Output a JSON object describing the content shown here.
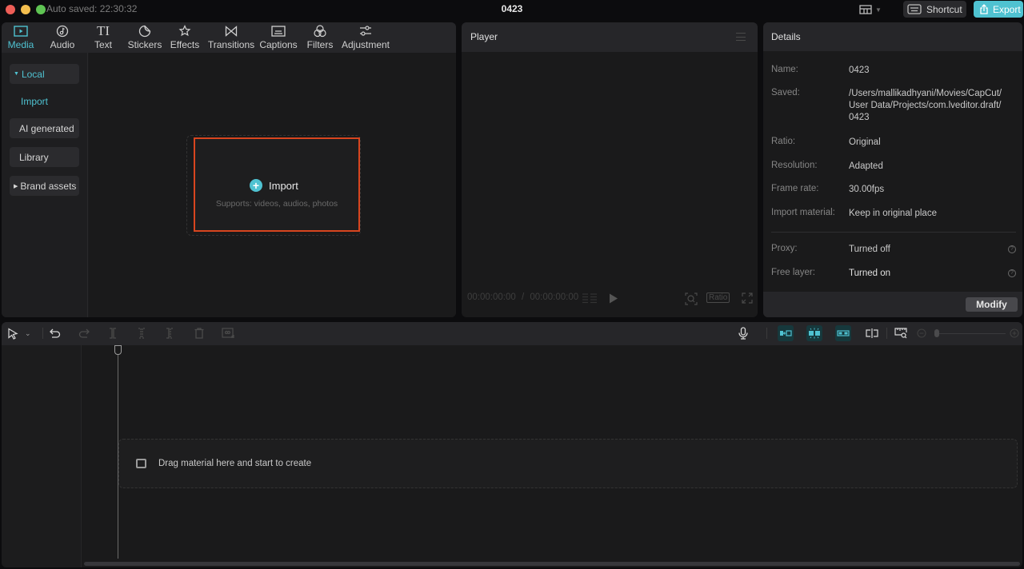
{
  "titlebar": {
    "autosave": "Auto saved: 22:30:32",
    "title": "0423",
    "shortcut_label": "Shortcut",
    "export_label": "Export"
  },
  "media_tabs": [
    {
      "label": "Media",
      "icon": "media-icon",
      "active": true
    },
    {
      "label": "Audio",
      "icon": "audio-icon"
    },
    {
      "label": "Text",
      "icon": "text-icon"
    },
    {
      "label": "Stickers",
      "icon": "stickers-icon"
    },
    {
      "label": "Effects",
      "icon": "effects-icon"
    },
    {
      "label": "Transitions",
      "icon": "transitions-icon"
    },
    {
      "label": "Captions",
      "icon": "captions-icon"
    },
    {
      "label": "Filters",
      "icon": "filters-icon"
    },
    {
      "label": "Adjustment",
      "icon": "adjustment-icon"
    }
  ],
  "sidebar": {
    "items": [
      {
        "label": "Local",
        "expanded": true,
        "active": true
      },
      {
        "label": "Import",
        "active": true
      },
      {
        "label": "AI generated"
      },
      {
        "label": "Library"
      },
      {
        "label": "Brand assets",
        "expanded": false
      }
    ]
  },
  "import_box": {
    "label": "Import",
    "supports": "Supports: videos, audios, photos"
  },
  "player": {
    "title": "Player",
    "current_time": "00:00:00:00",
    "separator": "/",
    "total_time": "00:00:00:00",
    "ratio_label": "Ratio"
  },
  "details": {
    "title": "Details",
    "rows": [
      {
        "key": "Name:",
        "value": "0423"
      },
      {
        "key": "Saved:",
        "value": "/Users/mallikadhyani/Movies/CapCut/ User Data/Projects/com.lveditor.draft/ 0423"
      },
      {
        "key": "Ratio:",
        "value": "Original"
      },
      {
        "key": "Resolution:",
        "value": "Adapted"
      },
      {
        "key": "Frame rate:",
        "value": "30.00fps"
      },
      {
        "key": "Import material:",
        "value": "Keep in original place"
      },
      {
        "key": "Proxy:",
        "value": "Turned off"
      },
      {
        "key": "Free layer:",
        "value": "Turned on"
      }
    ],
    "modify_label": "Modify"
  },
  "timeline": {
    "drop_hint": "Drag material here and start to create"
  },
  "colors": {
    "accent": "#4fc2d1",
    "highlight_border": "#d8451f",
    "background": "#1a1a1b"
  }
}
